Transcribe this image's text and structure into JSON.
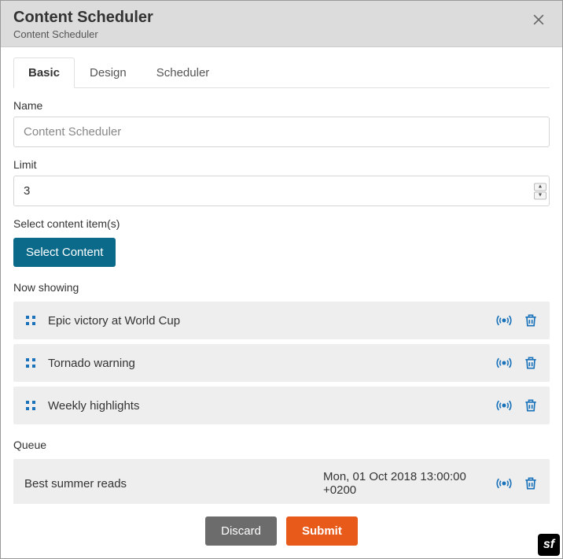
{
  "header": {
    "title": "Content Scheduler",
    "subtitle": "Content Scheduler"
  },
  "tabs": [
    {
      "label": "Basic",
      "active": true
    },
    {
      "label": "Design",
      "active": false
    },
    {
      "label": "Scheduler",
      "active": false
    }
  ],
  "form": {
    "name_label": "Name",
    "name_placeholder": "Content Scheduler",
    "name_value": "",
    "limit_label": "Limit",
    "limit_value": "3",
    "select_label": "Select content item(s)",
    "select_button": "Select Content"
  },
  "now_showing": {
    "label": "Now showing",
    "items": [
      {
        "title": "Epic victory at World Cup"
      },
      {
        "title": "Tornado warning"
      },
      {
        "title": "Weekly highlights"
      }
    ]
  },
  "queue": {
    "label": "Queue",
    "items": [
      {
        "title": "Best summer reads",
        "time": "Mon, 01 Oct 2018 13:00:00 +0200"
      }
    ]
  },
  "footer": {
    "discard": "Discard",
    "submit": "Submit"
  },
  "sf": "sf"
}
